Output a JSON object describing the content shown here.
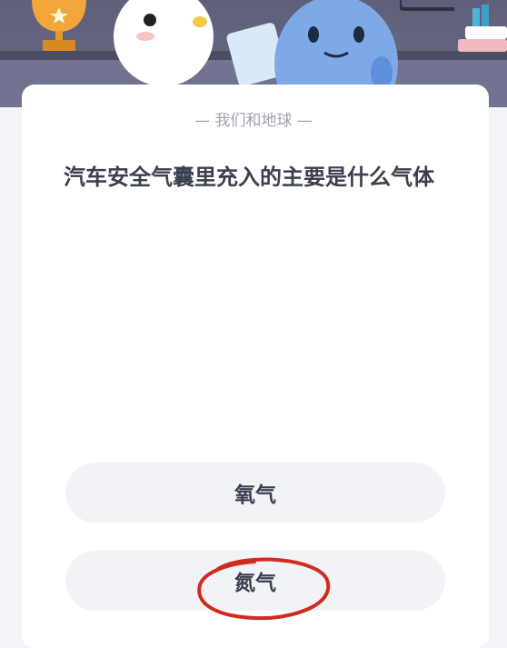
{
  "quiz": {
    "category": "— 我们和地球 —",
    "question": "汽车安全气囊里充入的主要是什么气体",
    "options": [
      {
        "label": "氧气"
      },
      {
        "label": "氮气"
      }
    ]
  },
  "colors": {
    "banner": "#5e6079",
    "card": "#ffffff",
    "option_bg": "#f1f3f6",
    "text": "#39404f",
    "annotation": "#d12a1f"
  },
  "icons": [
    "trophy-icon",
    "star-icon",
    "books-icon",
    "bird-mascot",
    "blue-mascot"
  ]
}
